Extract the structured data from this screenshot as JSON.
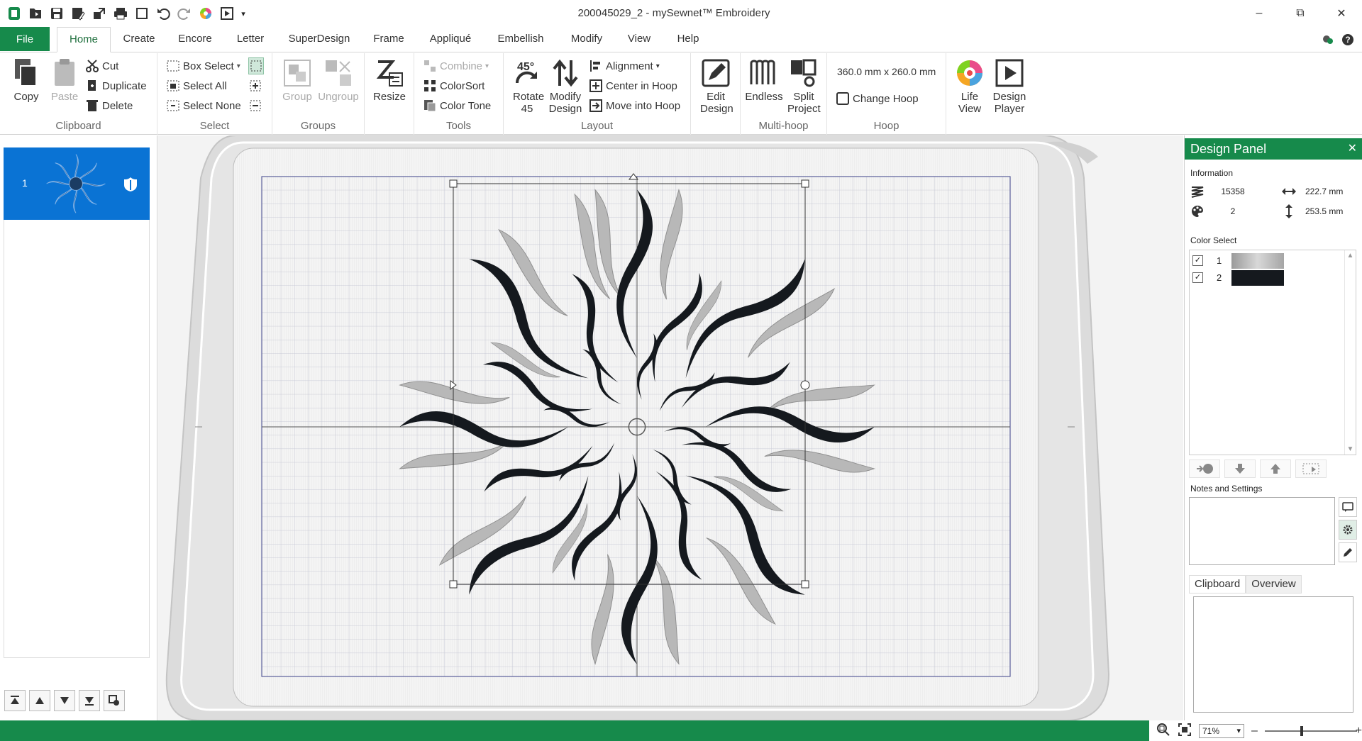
{
  "window": {
    "title": "200045029_2 -  mySewnet™ Embroidery",
    "minimize_icon": "minimize-icon",
    "restore_icon": "restore-icon",
    "close_icon": "close-icon"
  },
  "quick_access": [
    "app-icon",
    "open-icon",
    "save-icon",
    "save-as-icon",
    "export-icon",
    "print-icon",
    "new-window-icon",
    "undo-icon",
    "redo-icon",
    "color-wheel-icon",
    "play-icon",
    "qat-dropdown-icon"
  ],
  "tabs": {
    "file": "File",
    "items": [
      "Home",
      "Create",
      "Encore",
      "Letter",
      "SuperDesign",
      "Frame",
      "Appliqué",
      "Embellish",
      "Modify",
      "View",
      "Help"
    ],
    "active": "Home"
  },
  "ribbon": {
    "clipboard": {
      "label": "Clipboard",
      "copy": "Copy",
      "paste": "Paste",
      "cut": "Cut",
      "duplicate": "Duplicate",
      "delete": "Delete"
    },
    "select": {
      "label": "Select",
      "box_select": "Box Select",
      "select_all": "Select All",
      "select_none": "Select None"
    },
    "groups": {
      "label": "Groups",
      "group": "Group",
      "ungroup": "Ungroup"
    },
    "resize": {
      "label": "Resize"
    },
    "tools": {
      "label": "Tools",
      "combine": "Combine",
      "colorsort": "ColorSort",
      "color_tone": "Color Tone"
    },
    "layout": {
      "label": "Layout",
      "rotate": "Rotate 45",
      "modify": "Modify Design",
      "alignment": "Alignment",
      "center_in_hoop": "Center in Hoop",
      "move_into_hoop": "Move into Hoop"
    },
    "edit": {
      "edit_design": "Edit Design"
    },
    "multihoop": {
      "label": "Multi-hoop",
      "endless": "Endless",
      "split_project": "Split Project"
    },
    "hoop": {
      "label": "Hoop",
      "size": "360.0 mm x 260.0 mm",
      "change_hoop": "Change Hoop"
    },
    "view": {
      "life_view": "Life View",
      "design_player": "Design Player"
    }
  },
  "left_panel": {
    "design_number": "1",
    "order_buttons": [
      "move-to-top-icon",
      "move-up-icon",
      "move-down-icon",
      "move-to-bottom-icon",
      "design-properties-icon"
    ]
  },
  "design_panel": {
    "title": "Design Panel",
    "information_label": "Information",
    "stitches": "15358",
    "width": "222.7 mm",
    "colors": "2",
    "height": "253.5 mm",
    "color_select_label": "Color Select",
    "colors_list": [
      {
        "num": "1",
        "checked": true,
        "swatch": "#b5b5b5"
      },
      {
        "num": "2",
        "checked": true,
        "swatch": "#15191e"
      }
    ],
    "notes_label": "Notes and Settings",
    "clipboard_tab": "Clipboard",
    "overview_tab": "Overview"
  },
  "status": {
    "zoom": "71%"
  },
  "colors": {
    "brand_green": "#168a4b",
    "selection_blue": "#0a73d4",
    "design_dark": "#15191e",
    "design_light": "#b5b5b5"
  }
}
